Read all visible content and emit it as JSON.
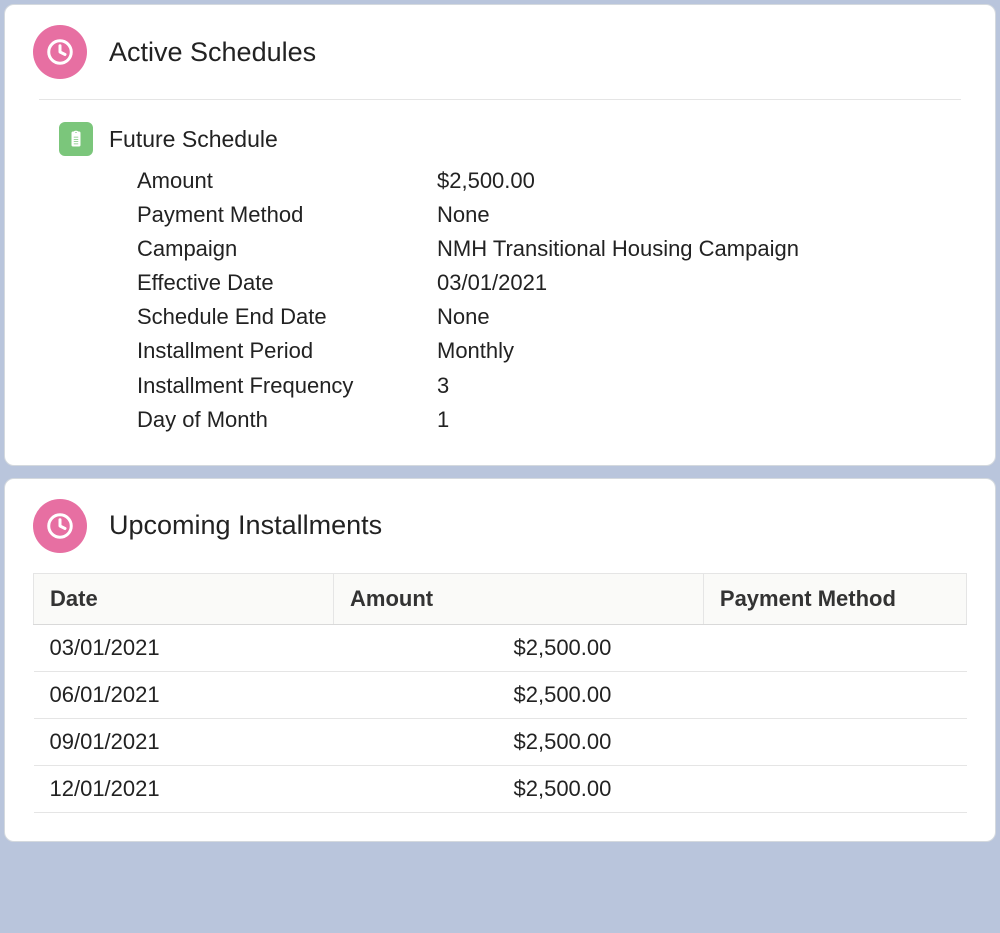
{
  "activeSchedules": {
    "title": "Active Schedules",
    "schedule": {
      "title": "Future Schedule",
      "fields": [
        {
          "label": "Amount",
          "value": "$2,500.00"
        },
        {
          "label": "Payment Method",
          "value": "None"
        },
        {
          "label": "Campaign",
          "value": "NMH Transitional Housing Campaign"
        },
        {
          "label": "Effective Date",
          "value": "03/01/2021"
        },
        {
          "label": "Schedule End Date",
          "value": "None"
        },
        {
          "label": "Installment Period",
          "value": "Monthly"
        },
        {
          "label": "Installment Frequency",
          "value": "3"
        },
        {
          "label": "Day of Month",
          "value": "1"
        }
      ]
    }
  },
  "upcoming": {
    "title": "Upcoming Installments",
    "columns": [
      "Date",
      "Amount",
      "Payment Method"
    ],
    "rows": [
      {
        "date": "03/01/2021",
        "amount": "$2,500.00",
        "method": ""
      },
      {
        "date": "06/01/2021",
        "amount": "$2,500.00",
        "method": ""
      },
      {
        "date": "09/01/2021",
        "amount": "$2,500.00",
        "method": ""
      },
      {
        "date": "12/01/2021",
        "amount": "$2,500.00",
        "method": ""
      }
    ]
  }
}
